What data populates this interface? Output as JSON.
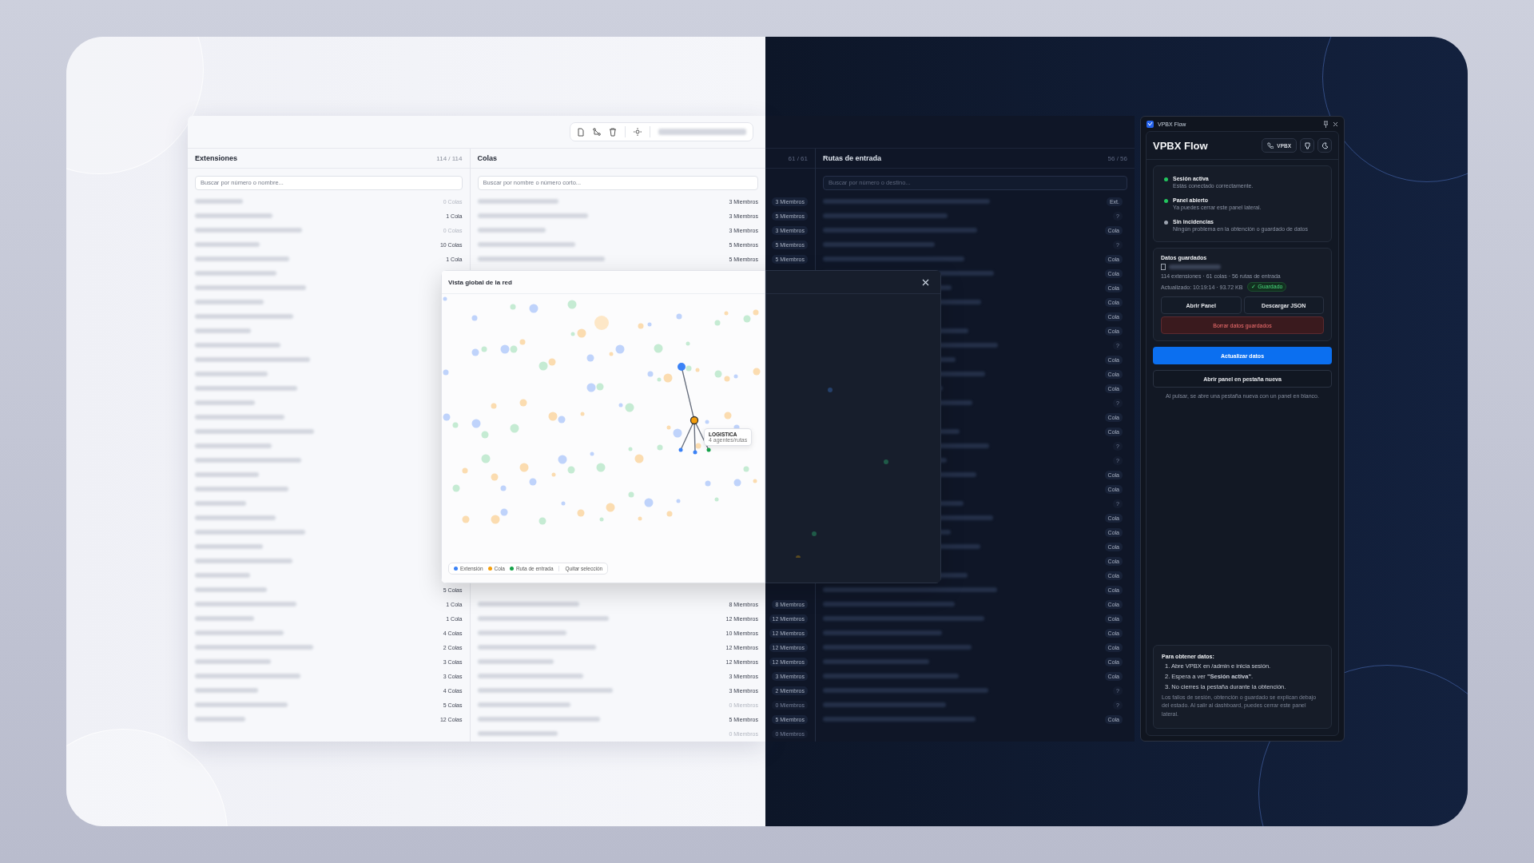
{
  "extensions": {
    "title": "Extensiones",
    "count": "114 / 114",
    "search_placeholder": "Buscar por número o nombre...",
    "top_rows": [
      {
        "count": "0 Colas",
        "muted": true
      },
      {
        "count": "1 Cola",
        "muted": false
      },
      {
        "count": "0 Colas",
        "muted": true
      },
      {
        "count": "10 Colas",
        "muted": false
      },
      {
        "count": "1 Cola",
        "muted": false
      }
    ],
    "bottom_rows": [
      {
        "count": "5 Colas",
        "muted": false
      },
      {
        "count": "1 Cola",
        "muted": false
      },
      {
        "count": "1 Cola",
        "muted": false
      },
      {
        "count": "4 Colas",
        "muted": false
      },
      {
        "count": "2 Colas",
        "muted": false
      },
      {
        "count": "3 Colas",
        "muted": false
      },
      {
        "count": "3 Colas",
        "muted": false
      },
      {
        "count": "4 Colas",
        "muted": false
      },
      {
        "count": "5 Colas",
        "muted": false
      },
      {
        "count": "12 Colas",
        "muted": false
      }
    ]
  },
  "queues": {
    "title": "Colas",
    "search_placeholder": "Buscar por nombre o número corto...",
    "top_rows": [
      {
        "count": "3 Miembros",
        "muted": false
      },
      {
        "count": "3 Miembros",
        "muted": false
      },
      {
        "count": "3 Miembros",
        "muted": false
      },
      {
        "count": "5 Miembros",
        "muted": false
      },
      {
        "count": "5 Miembros",
        "muted": false
      }
    ],
    "bottom_rows": [
      {
        "count": "8 Miembros",
        "muted": false
      },
      {
        "count": "12 Miembros",
        "muted": false
      },
      {
        "count": "10 Miembros",
        "muted": false
      },
      {
        "count": "12 Miembros",
        "muted": false
      },
      {
        "count": "12 Miembros",
        "muted": false
      },
      {
        "count": "3 Miembros",
        "muted": false
      },
      {
        "count": "3 Miembros",
        "muted": false
      },
      {
        "count": "0 Miembros",
        "muted": true
      },
      {
        "count": "5 Miembros",
        "muted": false
      },
      {
        "count": "0 Miembros",
        "muted": true
      }
    ]
  },
  "queues_dark": {
    "count": "61 / 61",
    "top_rows": [
      {
        "count": "3 Miembros",
        "muted": false
      },
      {
        "count": "5 Miembros",
        "muted": false
      },
      {
        "count": "3 Miembros",
        "muted": false
      },
      {
        "count": "5 Miembros",
        "muted": false
      },
      {
        "count": "5 Miembros",
        "muted": false
      }
    ],
    "bottom_rows": [
      {
        "count": "8 Miembros",
        "muted": false
      },
      {
        "count": "12 Miembros",
        "muted": false
      },
      {
        "count": "12 Miembros",
        "muted": false
      },
      {
        "count": "12 Miembros",
        "muted": false
      },
      {
        "count": "12 Miembros",
        "muted": false
      },
      {
        "count": "3 Miembros",
        "muted": false
      },
      {
        "count": "2 Miembros",
        "muted": false
      },
      {
        "count": "0 Miembros",
        "muted": true
      },
      {
        "count": "5 Miembros",
        "muted": false
      },
      {
        "count": "0 Miembros",
        "muted": true
      }
    ]
  },
  "routes": {
    "title": "Rutas de entrada",
    "count": "56 / 56",
    "search_placeholder": "Buscar por número o destino...",
    "rows": [
      {
        "tag": "Ext.",
        "muted": false
      },
      {
        "tag": "?",
        "muted": true
      },
      {
        "tag": "Cola",
        "muted": false
      },
      {
        "tag": "?",
        "muted": true
      },
      {
        "tag": "Cola",
        "muted": false
      },
      {
        "tag": "Cola",
        "muted": false
      },
      {
        "tag": "Cola",
        "muted": false
      },
      {
        "tag": "Cola",
        "muted": false
      },
      {
        "tag": "Cola",
        "muted": false
      },
      {
        "tag": "Cola",
        "muted": false
      },
      {
        "tag": "?",
        "muted": true
      },
      {
        "tag": "Cola",
        "muted": false
      },
      {
        "tag": "Cola",
        "muted": false
      },
      {
        "tag": "Cola",
        "muted": false
      },
      {
        "tag": "?",
        "muted": true
      },
      {
        "tag": "Cola",
        "muted": false
      },
      {
        "tag": "Cola",
        "muted": false
      },
      {
        "tag": "?",
        "muted": true
      },
      {
        "tag": "?",
        "muted": true
      },
      {
        "tag": "Cola",
        "muted": false
      },
      {
        "tag": "Cola",
        "muted": false
      },
      {
        "tag": "?",
        "muted": true
      },
      {
        "tag": "Cola",
        "muted": false
      },
      {
        "tag": "Cola",
        "muted": false
      },
      {
        "tag": "Cola",
        "muted": false
      },
      {
        "tag": "Cola",
        "muted": false
      },
      {
        "tag": "Cola",
        "muted": false
      },
      {
        "tag": "Cola",
        "muted": false
      },
      {
        "tag": "Cola",
        "muted": false
      },
      {
        "tag": "Cola",
        "muted": false
      },
      {
        "tag": "Cola",
        "muted": false
      },
      {
        "tag": "Cola",
        "muted": false
      },
      {
        "tag": "Cola",
        "muted": false
      },
      {
        "tag": "Cola",
        "muted": false
      },
      {
        "tag": "?",
        "muted": true
      },
      {
        "tag": "?",
        "muted": true
      },
      {
        "tag": "Cola",
        "muted": false
      }
    ]
  },
  "network_modal": {
    "title": "Vista global de la red",
    "tooltip": {
      "title": "LOGISTICA",
      "subtitle": "4 agentes/rutas"
    },
    "legend": [
      {
        "label": "Extensión",
        "color": "#3b82f6"
      },
      {
        "label": "Cola",
        "color": "#f59e0b"
      },
      {
        "label": "Ruta de entrada",
        "color": "#16a34a"
      }
    ],
    "clear_button": "Quitar selección"
  },
  "side_panel": {
    "window_title": "VPBX Flow",
    "title": "VPBX Flow",
    "vpbx_button": "VPBX",
    "status": [
      {
        "title": "Sesión activa",
        "detail": "Estás conectado correctamente.",
        "color": "#22c55e"
      },
      {
        "title": "Panel abierto",
        "detail": "Ya puedes cerrar este panel lateral.",
        "color": "#22c55e"
      },
      {
        "title": "Sin incidencias",
        "detail": "Ningún problema en la obtención o guardado de datos",
        "color": "#9ca3af"
      }
    ],
    "saved": {
      "title": "Datos guardados",
      "summary": "114 extensiones · 61 colas · 56 rutas de entrada",
      "updated": "Actualizado: 10:19:14 · 93.72 KB",
      "badge": "✓ Guardado"
    },
    "buttons": [
      {
        "label": "Abrir Panel",
        "kind": "secondary"
      },
      {
        "label": "Descargar JSON",
        "kind": "secondary"
      },
      {
        "label": "Borrar datos guardados",
        "kind": "danger"
      }
    ],
    "actions": [
      {
        "label": "Actualizar datos",
        "kind": "primary"
      },
      {
        "label": "Abrir panel en pestaña nueva",
        "kind": "outline"
      }
    ],
    "hint": "Al pulsar, se abre una pestaña nueva con un panel en blanco.",
    "help": {
      "title": "Para obtener datos:",
      "steps": [
        "1. Abre VPBX en /admin e inicia sesión.",
        "2. Espera a ver **\"Sesión activa\"**.",
        "3. No cierres la pestaña durante la obtención."
      ],
      "note": "Los fallos de sesión, obtención o guardado se explican debajo del estado. Al salir al dashboard, puedes cerrar este panel lateral."
    }
  }
}
